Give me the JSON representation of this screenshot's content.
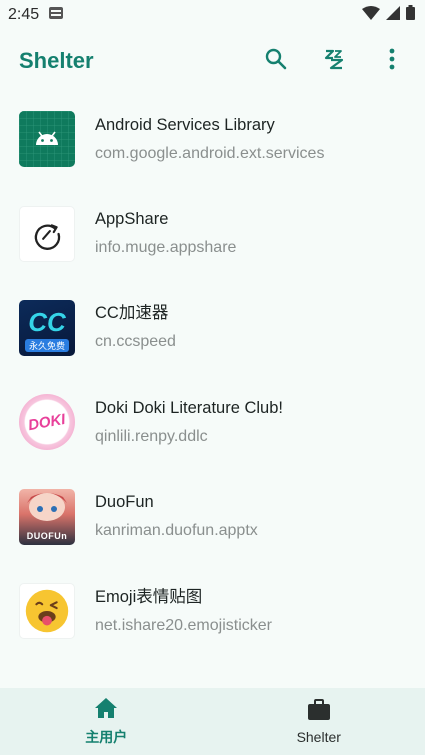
{
  "status_bar": {
    "time": "2:45"
  },
  "app_bar": {
    "title": "Shelter",
    "icons": [
      "search-icon",
      "snooze-icon",
      "more-vert-icon"
    ]
  },
  "apps": [
    {
      "name": "Android Services Library",
      "package": "com.google.android.ext.services",
      "icon": "android-icon"
    },
    {
      "name": "AppShare",
      "package": "info.muge.appshare",
      "icon": "appshare-icon"
    },
    {
      "name": "CC加速器",
      "package": "cn.ccspeed",
      "icon": "cc-icon",
      "icon_text": "CC",
      "icon_subtext": "永久免费"
    },
    {
      "name": "Doki Doki Literature Club!",
      "package": "qinlili.renpy.ddlc",
      "icon": "ddlc-icon",
      "icon_text": "DOKI"
    },
    {
      "name": "DuoFun",
      "package": "kanriman.duofun.apptx",
      "icon": "duofun-icon",
      "icon_text": "DUOFUn"
    },
    {
      "name": "Emoji表情贴图",
      "package": "net.ishare20.emojisticker",
      "icon": "emoji-icon"
    }
  ],
  "bottom_nav": {
    "items": [
      {
        "label": "主用户",
        "icon": "home-icon",
        "active": true
      },
      {
        "label": "Shelter",
        "icon": "briefcase-icon",
        "active": false
      }
    ]
  },
  "colors": {
    "accent": "#15806f",
    "background": "#f6fbf9",
    "nav_background": "#e7f3f0"
  }
}
